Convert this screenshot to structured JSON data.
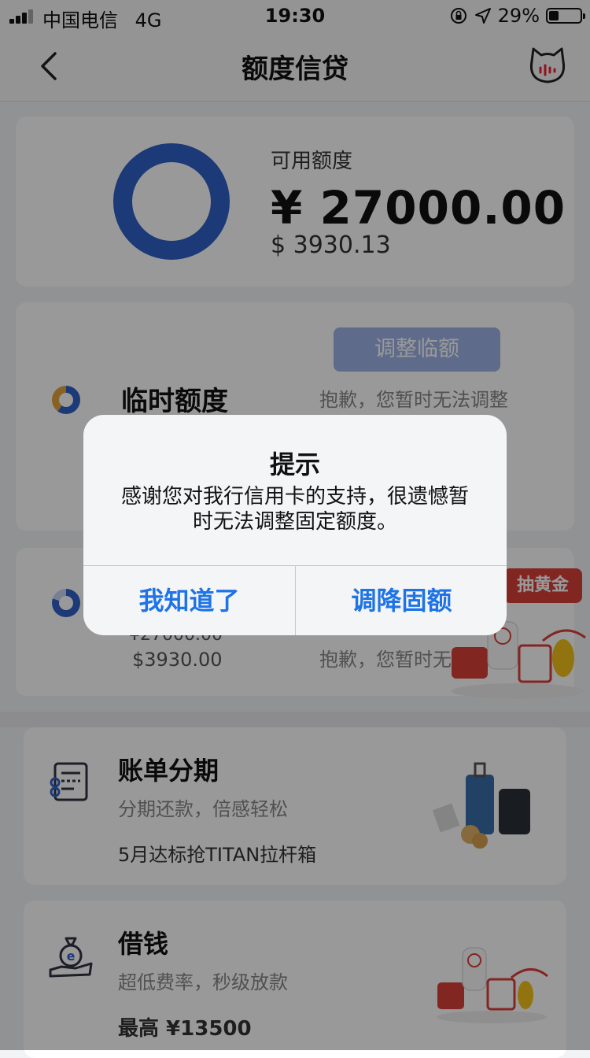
{
  "status_bar": {
    "carrier": "中国电信",
    "network": "4G",
    "time": "19:30",
    "battery": "29%"
  },
  "nav": {
    "title": "额度信贷"
  },
  "available": {
    "label": "可用额度",
    "cny": "¥ 27000.00",
    "usd": "$ 3930.13"
  },
  "temporary": {
    "title": "临时额度",
    "adjust_button": "调整临额",
    "notice": "抱歉，您暂时无法调整"
  },
  "fixed": {
    "cny": "¥27000.00",
    "usd": "$3930.00",
    "notice": "抱歉，您暂时无法调"
  },
  "promo": {
    "tag": "抽黄金"
  },
  "services": [
    {
      "title": "账单分期",
      "subtitle": "分期还款，倍感轻松",
      "extra": "5月达标抢TITAN拉杆箱"
    },
    {
      "title": "借钱",
      "subtitle": "超低费率，秒级放款",
      "extra": "最高 ¥13500"
    }
  ],
  "dialog": {
    "title": "提示",
    "message": "感谢您对我行信用卡的支持，很遗憾暂时无法调整固定额度。",
    "btn_ok": "我知道了",
    "btn_reduce": "调降固额"
  }
}
